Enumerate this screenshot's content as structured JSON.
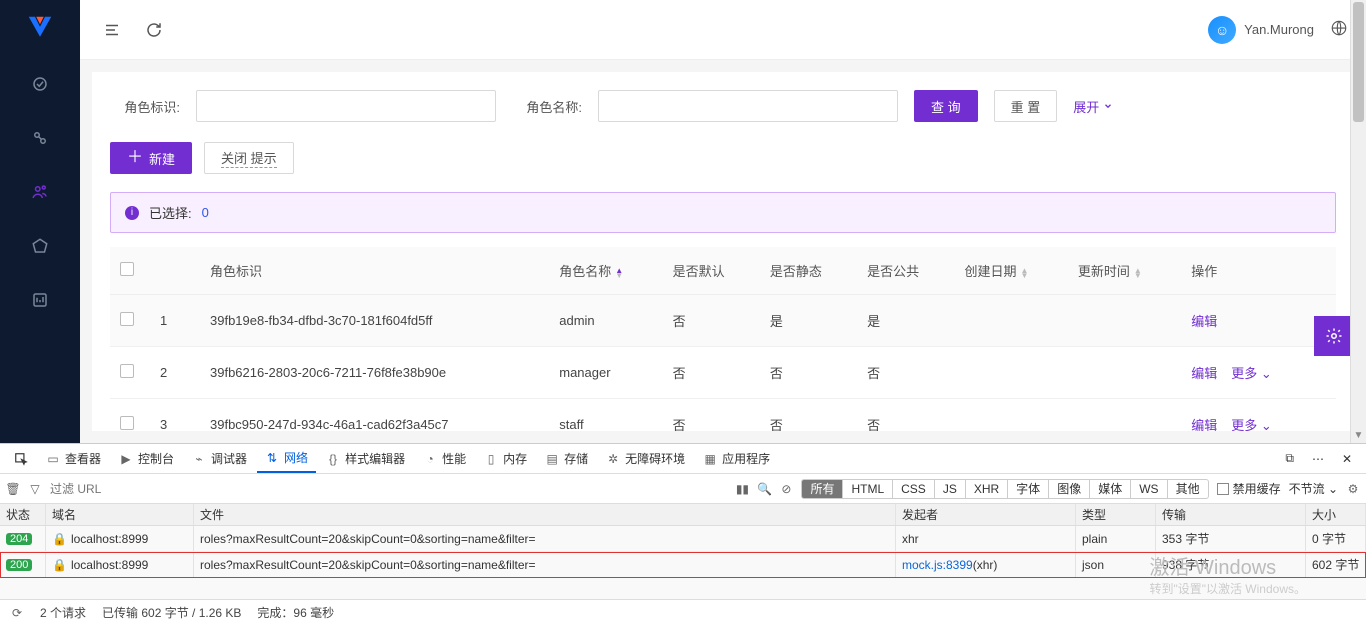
{
  "header": {
    "username": "Yan.Murong"
  },
  "filters": {
    "role_id_label": "角色标识:",
    "role_name_label": "角色名称:",
    "search_btn": "查 询",
    "reset_btn": "重 置",
    "expand_link": "展开"
  },
  "actions": {
    "new_btn": "新建",
    "close_tip_btn": "关闭 提示"
  },
  "alert": {
    "prefix": "已选择:",
    "count": "0"
  },
  "columns": {
    "role_id": "角色标识",
    "role_name": "角色名称",
    "is_default": "是否默认",
    "is_static": "是否静态",
    "is_public": "是否公共",
    "created": "创建日期",
    "updated": "更新时间",
    "ops": "操作"
  },
  "ops": {
    "edit": "编辑",
    "more": "更多"
  },
  "rows": [
    {
      "idx": "1",
      "id": "39fb19e8-fb34-dfbd-3c70-181f604fd5ff",
      "name": "admin",
      "def": "否",
      "stat": "是",
      "pub": "是",
      "more": false
    },
    {
      "idx": "2",
      "id": "39fb6216-2803-20c6-7211-76f8fe38b90e",
      "name": "manager",
      "def": "否",
      "stat": "否",
      "pub": "否",
      "more": true
    },
    {
      "idx": "3",
      "id": "39fbc950-247d-934c-46a1-cad62f3a45c7",
      "name": "staff",
      "def": "否",
      "stat": "否",
      "pub": "否",
      "more": true
    }
  ],
  "devtools": {
    "tabs": {
      "inspector": "查看器",
      "console": "控制台",
      "debugger": "调试器",
      "network": "网络",
      "style": "样式编辑器",
      "perf": "性能",
      "memory": "内存",
      "storage": "存储",
      "a11y": "无障碍环境",
      "app": "应用程序"
    },
    "filter_placeholder": "过滤 URL",
    "types": {
      "all": "所有",
      "html": "HTML",
      "css": "CSS",
      "js": "JS",
      "xhr": "XHR",
      "font": "字体",
      "img": "图像",
      "media": "媒体",
      "ws": "WS",
      "other": "其他"
    },
    "disable_cache": "禁用缓存",
    "throttle": "不节流",
    "cols": {
      "status": "状态",
      "domain": "域名",
      "file": "文件",
      "initiator": "发起者",
      "type": "类型",
      "transferred": "传输",
      "size": "大小"
    },
    "requests": [
      {
        "status": "204",
        "domain": "localhost:8999",
        "file": "roles?maxResultCount=20&skipCount=0&sorting=name&filter=",
        "initiator": "xhr",
        "initiator_link": false,
        "type": "plain",
        "transferred": "353 字节",
        "size": "0 字节",
        "hl": false
      },
      {
        "status": "200",
        "domain": "localhost:8999",
        "file": "roles?maxResultCount=20&skipCount=0&sorting=name&filter=",
        "initiator": "mock.js:8399",
        "initiator_suffix": " (xhr)",
        "initiator_link": true,
        "type": "json",
        "transferred": "938 字节",
        "size": "602 字节",
        "hl": true
      }
    ],
    "statusbar": {
      "count": "2 个请求",
      "transfer": "已传输 602 字节 / 1.26 KB",
      "time": "完成：96 毫秒"
    }
  },
  "watermark": {
    "title": "激活 Windows",
    "sub": "转到\"设置\"以激活 Windows。"
  }
}
